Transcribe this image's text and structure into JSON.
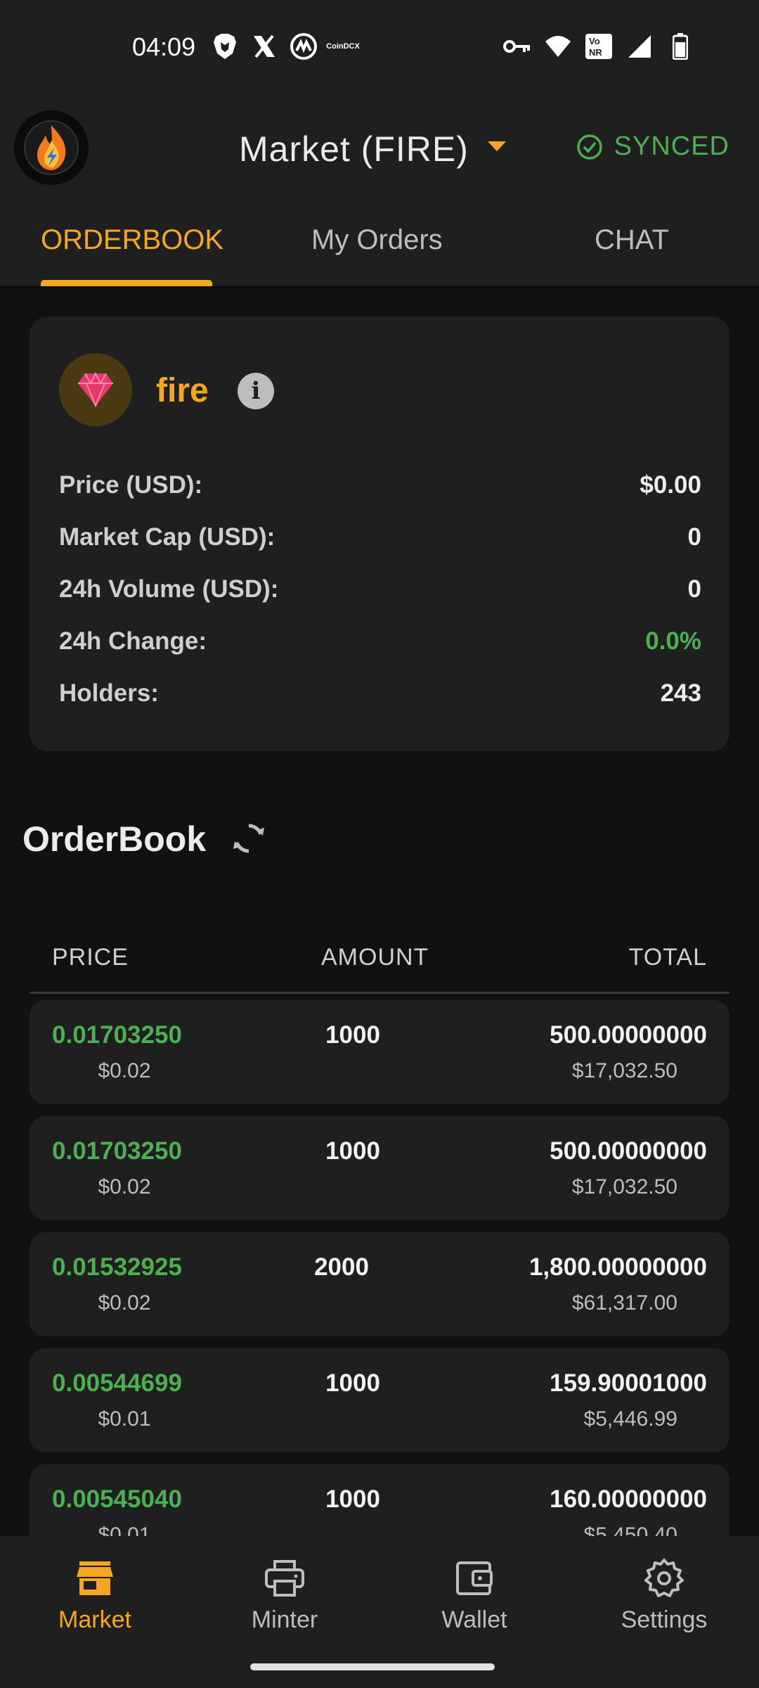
{
  "status_bar": {
    "time": "04:09",
    "left_icons": [
      "brave-icon",
      "x-icon",
      "coinmarketcap-icon",
      "coindcx-icon"
    ],
    "coindcx_label": "CoinDCX",
    "right_icons": [
      "vpn-key-icon",
      "wifi-icon",
      "vonr-icon",
      "signal-icon",
      "battery-icon"
    ],
    "vonr_label": "Vo NR"
  },
  "app_bar": {
    "title": "Market (FIRE)",
    "sync_status": "SYNCED"
  },
  "tabs": [
    {
      "label": "ORDERBOOK",
      "active": true
    },
    {
      "label": "My Orders",
      "active": false
    },
    {
      "label": "CHAT",
      "active": false
    }
  ],
  "token": {
    "name": "fire",
    "stats": [
      {
        "label": "Price (USD):",
        "value": "$0.00"
      },
      {
        "label": "Market Cap (USD):",
        "value": "0"
      },
      {
        "label": "24h Volume (USD):",
        "value": "0"
      },
      {
        "label": "24h Change:",
        "value": "0.0%"
      },
      {
        "label": "Holders:",
        "value": "243"
      }
    ]
  },
  "orderbook": {
    "title": "OrderBook",
    "columns": [
      "PRICE",
      "AMOUNT",
      "TOTAL"
    ],
    "rows": [
      {
        "price": "0.01703250",
        "price_usd": "$0.02",
        "amount": "1000",
        "total": "500.00000000",
        "total_usd": "$17,032.50"
      },
      {
        "price": "0.01703250",
        "price_usd": "$0.02",
        "amount": "1000",
        "total": "500.00000000",
        "total_usd": "$17,032.50"
      },
      {
        "price": "0.01532925",
        "price_usd": "$0.02",
        "amount": "2000",
        "total": "1,800.00000000",
        "total_usd": "$61,317.00"
      },
      {
        "price": "0.00544699",
        "price_usd": "$0.01",
        "amount": "1000",
        "total": "159.90001000",
        "total_usd": "$5,446.99"
      },
      {
        "price": "0.00545040",
        "price_usd": "$0.01",
        "amount": "1000",
        "total": "160.00000000",
        "total_usd": "$5,450.40"
      }
    ]
  },
  "bottom_nav": [
    {
      "label": "Market",
      "icon": "store-icon",
      "active": true
    },
    {
      "label": "Minter",
      "icon": "printer-icon",
      "active": false
    },
    {
      "label": "Wallet",
      "icon": "wallet-icon",
      "active": false
    },
    {
      "label": "Settings",
      "icon": "gear-icon",
      "active": false
    }
  ],
  "colors": {
    "accent": "#f5a623",
    "positive": "#4caf50",
    "surface": "#1f1f1f",
    "background": "#111111"
  }
}
